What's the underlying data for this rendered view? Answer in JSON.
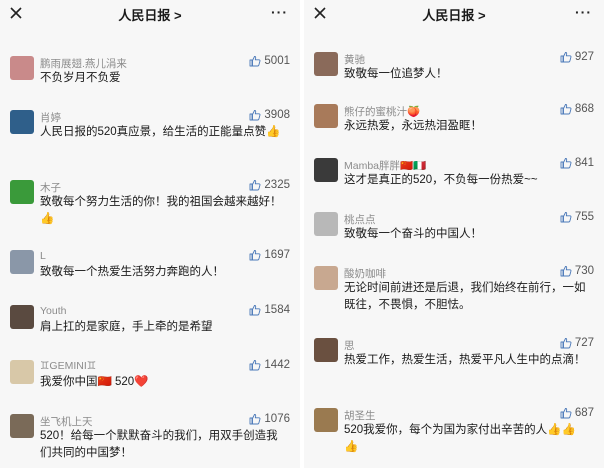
{
  "left": {
    "title": "人民日报 >",
    "more": "···",
    "comments": [
      {
        "name": "鹏雨展翅.燕儿涓来",
        "likes": "5001",
        "text": "不负岁月不负爱",
        "avatar_color": "#c98a8a"
      },
      {
        "name": "肖婷",
        "likes": "3908",
        "text": "人民日报的520真应景，给生活的正能量点赞👍",
        "avatar_color": "#2f5f8a"
      },
      {
        "name": "木子",
        "likes": "2325",
        "text": "致敬每个努力生活的你！我的祖国会越来越好！👍",
        "avatar_color": "#3a9a3a"
      },
      {
        "name": "L",
        "likes": "1697",
        "text": "致敬每一个热爱生活努力奔跑的人！",
        "avatar_color": "#8a97a8"
      },
      {
        "name": "Youth",
        "likes": "1584",
        "text": "肩上扛的是家庭，手上牵的是希望",
        "avatar_color": "#5a4a40"
      },
      {
        "name": "♊GEMINI♊",
        "likes": "1442",
        "text": "我爱你中国🇨🇳 520❤️",
        "avatar_color": "#d8c8a8"
      },
      {
        "name": "坐飞机上天",
        "likes": "1076",
        "text": "520！给每一个默默奋斗的我们，用双手创造我们共同的中国梦！",
        "avatar_color": "#7a6a58"
      }
    ]
  },
  "right": {
    "title": "人民日报 >",
    "more": "···",
    "comments": [
      {
        "name": "黄驰",
        "likes": "927",
        "text": "致敬每一位追梦人！",
        "avatar_color": "#8a6a5a"
      },
      {
        "name": "熊仔的蜜桃汁🍑",
        "likes": "868",
        "text": "永远热爱，永远热泪盈眶！",
        "avatar_color": "#a87a5a"
      },
      {
        "name": "Mamba胖胖🇨🇳🇮🇹",
        "likes": "841",
        "text": "这才是真正的520，不负每一份热爱~~",
        "avatar_color": "#3a3a3a"
      },
      {
        "name": "桃点点",
        "likes": "755",
        "text": "致敬每一个奋斗的中国人！",
        "avatar_color": "#b8b8b8"
      },
      {
        "name": "酸奶咖啡",
        "likes": "730",
        "text": "无论时间前进还是后退，我们始终在前行，一如既往，不畏惧，不胆怯。",
        "avatar_color": "#c8a890"
      },
      {
        "name": "思",
        "likes": "727",
        "text": "热爱工作，热爱生活，热爱平凡人生中的点滴！",
        "avatar_color": "#6a5040"
      },
      {
        "name": "胡圣生",
        "likes": "687",
        "text": "520我爱你，每个为国为家付出辛苦的人👍👍👍",
        "avatar_color": "#9a7a50"
      }
    ]
  },
  "colors": {
    "background": "#f7f7f7",
    "name": "#8c8c8c",
    "text": "#1a1a1a",
    "likes": "#555555"
  }
}
